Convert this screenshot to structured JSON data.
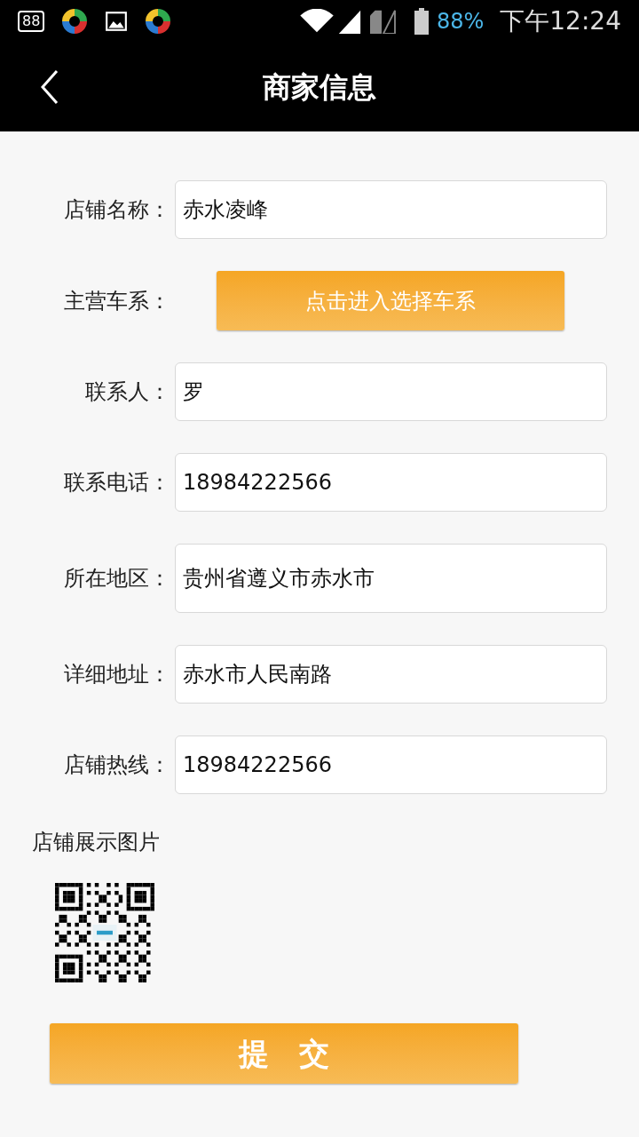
{
  "status_bar": {
    "notification_badge": "88",
    "battery_percent": "88%",
    "time": "下午12:24"
  },
  "header": {
    "title": "商家信息"
  },
  "form": [
    {
      "kind": "field",
      "label": "店铺名称：",
      "value": "赤水凌峰"
    },
    {
      "kind": "button",
      "label": "主营车系：",
      "value": "点击进入选择车系"
    },
    {
      "kind": "field",
      "label": "联系人：",
      "value": "罗"
    },
    {
      "kind": "field",
      "label": "联系电话：",
      "value": "18984222566"
    },
    {
      "kind": "field",
      "label": "所在地区：",
      "value": "贵州省遵义市赤水市",
      "tall": true
    },
    {
      "kind": "field",
      "label": "详细地址：",
      "value": "赤水市人民南路"
    },
    {
      "kind": "field",
      "label": "店铺热线：",
      "value": "18984222566"
    }
  ],
  "gallery": {
    "title": "店铺展示图片"
  },
  "submit": {
    "label": "提　交"
  }
}
